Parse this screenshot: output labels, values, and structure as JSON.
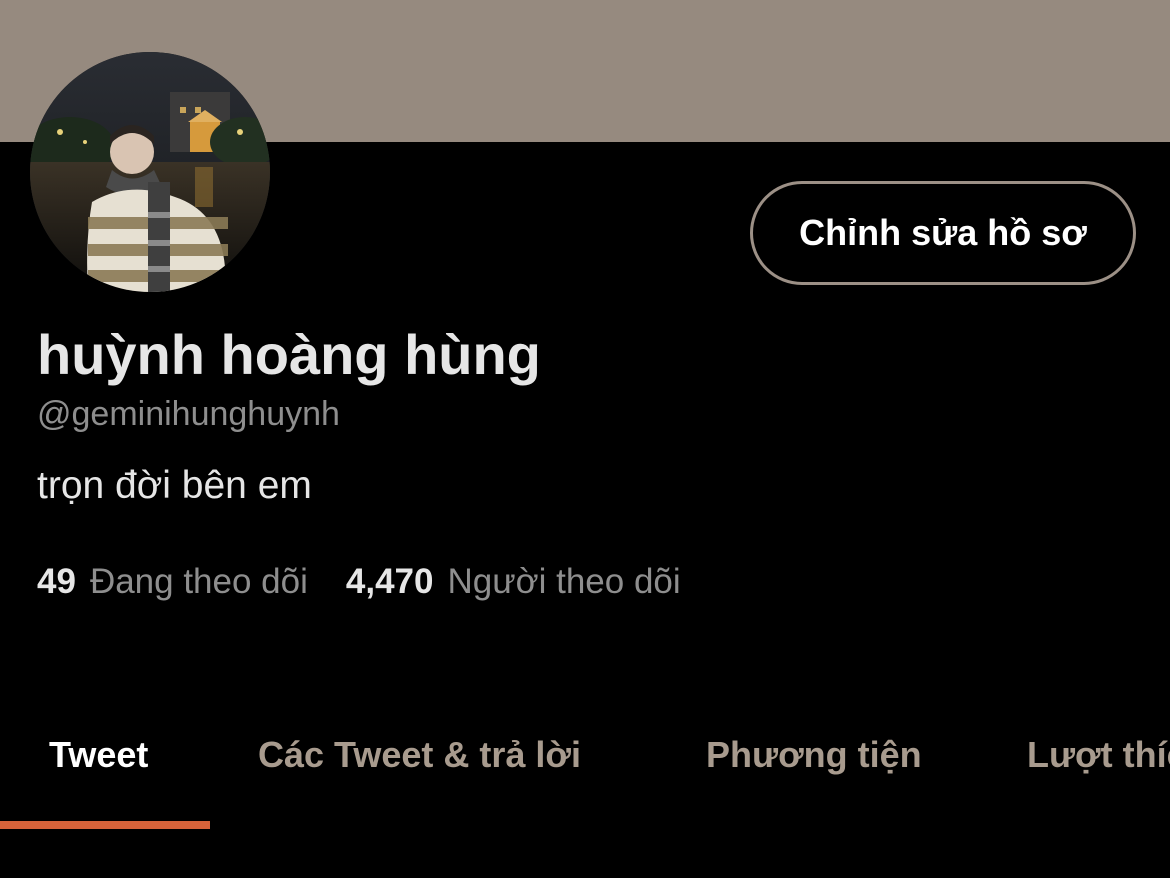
{
  "profile": {
    "display_name": "huỳnh hoàng hùng",
    "handle": "@geminihunghuynh",
    "bio": "trọn đời bên em",
    "edit_button_label": "Chỉnh sửa hồ sơ"
  },
  "stats": {
    "following_count": "49",
    "following_label": "Đang theo dõi",
    "followers_count": "4,470",
    "followers_label": "Người theo dõi"
  },
  "tabs": [
    {
      "label": "Tweet",
      "active": true
    },
    {
      "label": "Các Tweet & trả lời",
      "active": false
    },
    {
      "label": "Phương tiện",
      "active": false
    },
    {
      "label": "Lượt thích",
      "active": false
    }
  ],
  "colors": {
    "background": "#000000",
    "banner": "#968a7f",
    "accent": "#d8633a",
    "text_primary": "#e6e6e6",
    "text_secondary": "#8e8e8e",
    "tab_inactive": "#a89b8e",
    "button_border": "#9c9086"
  }
}
